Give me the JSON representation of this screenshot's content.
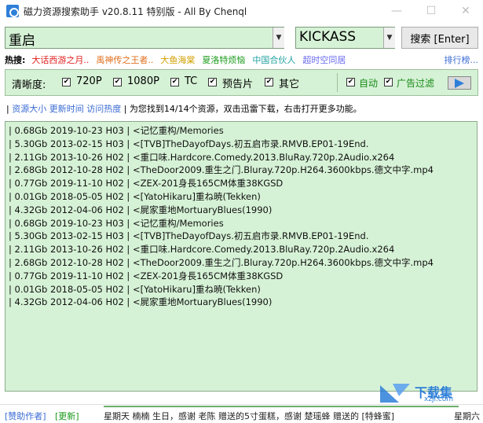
{
  "window": {
    "title": "磁力资源搜索助手 v20.8.11 特别版 - All By Chenql",
    "minimize_glyph": "—",
    "maximize_glyph": "☐",
    "close_glyph": "✕"
  },
  "search": {
    "query": "重启",
    "engine": "KICKASS",
    "button_label": "搜索 [Enter]"
  },
  "hotwords": {
    "label": "热搜:",
    "items": [
      {
        "text": "大话西游之月..",
        "color": "#e02020"
      },
      {
        "text": "禹神传之王者..",
        "color": "#e07020"
      },
      {
        "text": "大鱼海棠",
        "color": "#d0a000"
      },
      {
        "text": "夏洛特烦恼",
        "color": "#1a9a1a"
      },
      {
        "text": "中国合伙人",
        "color": "#20a0a0"
      },
      {
        "text": "超时空同居",
        "color": "#6a6af0"
      }
    ],
    "more_label": "排行榜..."
  },
  "filters": {
    "label": "清晰度:",
    "options": [
      {
        "label": "720P",
        "checked": true
      },
      {
        "label": "1080P",
        "checked": true
      },
      {
        "label": "TC",
        "checked": true
      },
      {
        "label": "预告片",
        "checked": true
      },
      {
        "label": "其它",
        "checked": true
      }
    ],
    "auto": {
      "label": "自动",
      "checked": true
    },
    "ad_filter": {
      "label": "广告过滤",
      "checked": true
    },
    "check_glyph": "✔"
  },
  "info": {
    "sort_size": "资源大小",
    "sort_time": "更新时间",
    "sort_hits": "访问热度",
    "message": "| 为您找到14/14个资源，双击迅雷下载，右击打开更多功能。"
  },
  "results": [
    "| 0.68Gb 2019-10-23 H03 | <记忆重构/Memories",
    "| 5.30Gb 2013-02-15 H03 | <[TVB]TheDayofDays.初五启市录.RMVB.EP01-19End.",
    "| 2.11Gb 2013-10-26 H02 | <重口味.Hardcore.Comedy.2013.BluRay.720p.2Audio.x264",
    "| 2.68Gb 2012-10-28 H02 | <TheDoor2009.重生之门.Bluray.720p.H264.3600kbps.德文中字.mp4",
    "| 0.77Gb 2019-11-10 H02 | <ZEX-201身長165CM体重38KGSD",
    "| 0.01Gb 2018-05-05 H02 | <[YatoHikaru]重ね暁(Tekken)",
    "| 4.32Gb 2012-04-06 H02 | <屍家重地MortuaryBlues(1990)",
    "| 0.68Gb 2019-10-23 H03 | <记忆重构/Memories",
    "| 5.30Gb 2013-02-15 H03 | <[TVB]TheDayofDays.初五启市录.RMVB.EP01-19End.",
    "| 2.11Gb 2013-10-26 H02 | <重口味.Hardcore.Comedy.2013.BluRay.720p.2Audio.x264",
    "| 2.68Gb 2012-10-28 H02 | <TheDoor2009.重生之门.Bluray.720p.H264.3600kbps.德文中字.mp4",
    "| 0.77Gb 2019-11-10 H02 | <ZEX-201身長165CM体重38KGSD",
    "| 0.01Gb 2018-05-05 H02 | <[YatoHikaru]重ね暁(Tekken)",
    "| 4.32Gb 2012-04-06 H02 | <屍家重地MortuaryBlues(1990)"
  ],
  "status": {
    "sponsor": "[赞助作者]",
    "update": "[更新]",
    "marquee": "星期天 楠楠 生日，感谢 老陈 赠送的5寸蛋糕，感谢 楚瑶蜂 赠送的 [特蜂蜜]",
    "weekday": "星期六"
  },
  "watermark": {
    "text": "下载集",
    "sub": "xzji.com"
  }
}
